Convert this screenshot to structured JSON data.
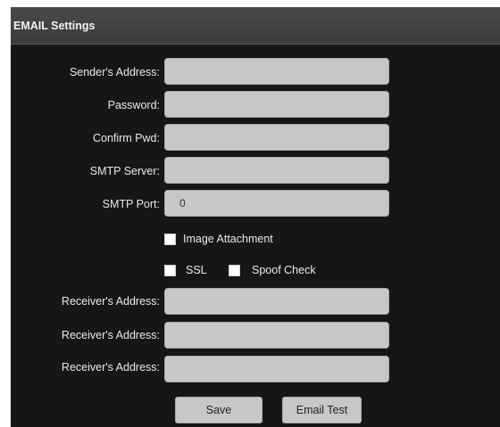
{
  "header": {
    "title": "EMAIL Settings"
  },
  "form": {
    "sender_address": {
      "label": "Sender's Address:",
      "value": ""
    },
    "password": {
      "label": "Password:",
      "value": ""
    },
    "confirm_pwd": {
      "label": "Confirm Pwd:",
      "value": ""
    },
    "smtp_server": {
      "label": "SMTP Server:",
      "value": ""
    },
    "smtp_port": {
      "label": "SMTP Port:",
      "value": "0"
    },
    "image_attachment": {
      "label": "Image Attachment",
      "checked": false
    },
    "ssl": {
      "label": "SSL",
      "checked": false
    },
    "spoof_check": {
      "label": "Spoof Check",
      "checked": false
    },
    "receivers": [
      {
        "label": "Receiver's Address:",
        "value": ""
      },
      {
        "label": "Receiver's Address:",
        "value": ""
      },
      {
        "label": "Receiver's Address:",
        "value": ""
      }
    ]
  },
  "actions": {
    "save_label": "Save",
    "email_test_label": "Email Test"
  }
}
